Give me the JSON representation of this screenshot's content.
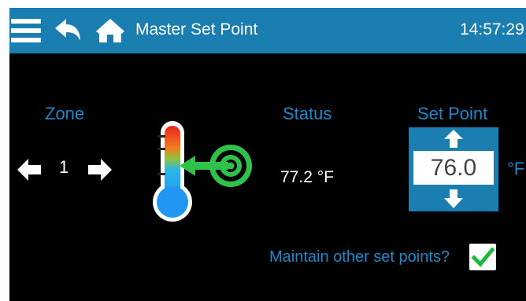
{
  "header": {
    "title": "Master Set Point",
    "time": "14:57:29"
  },
  "icons": {
    "menu": "hamburger-menu-icon",
    "back": "back-arrow-icon",
    "home": "home-icon"
  },
  "zone": {
    "label": "Zone",
    "value": "1"
  },
  "status": {
    "label": "Status",
    "temperature": "77.2 °F"
  },
  "set_point": {
    "label": "Set Point",
    "value": "76.0",
    "unit": "°F"
  },
  "maintain": {
    "label": "Maintain other set points?",
    "checked": true
  },
  "colors": {
    "header_bar": "#1a7fb0",
    "label_blue": "#1e88c8",
    "check_green": "#1eb83a",
    "background": "#000000"
  }
}
